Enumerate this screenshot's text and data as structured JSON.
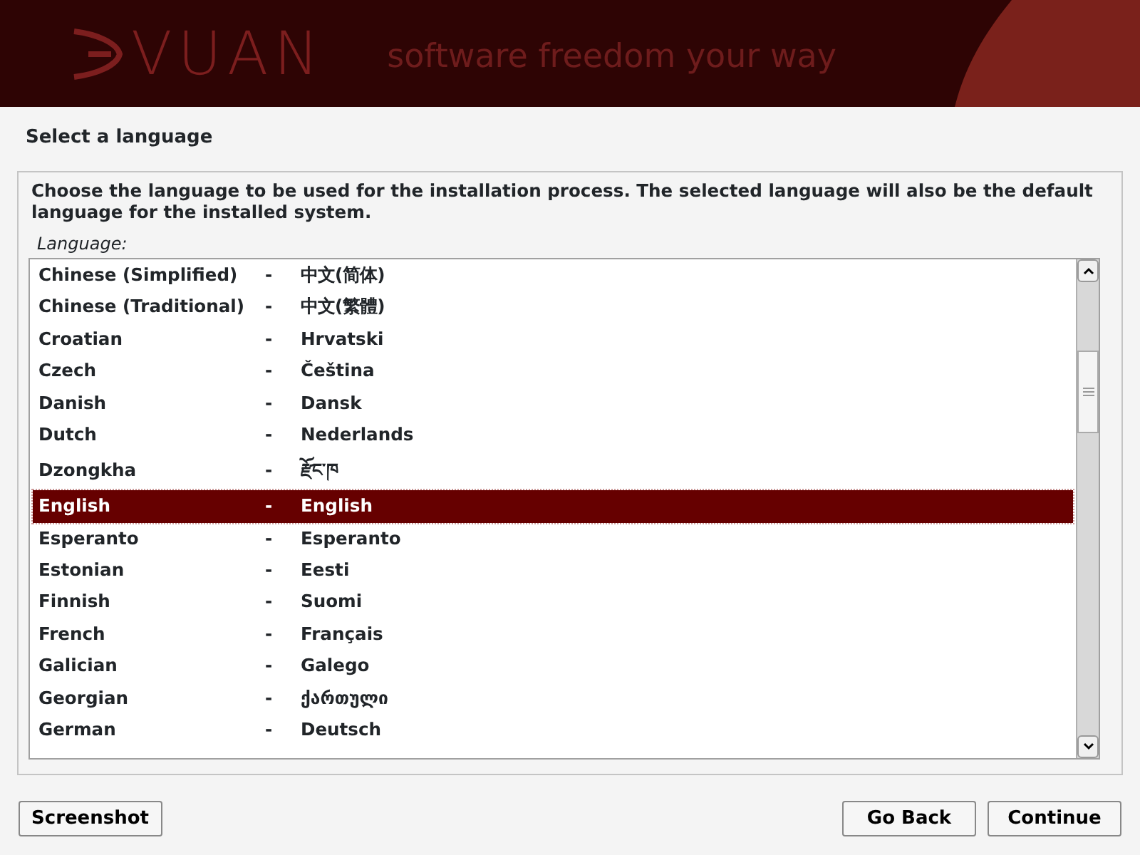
{
  "header": {
    "brand": "VUAN",
    "tagline": "software freedom your way"
  },
  "title": "Select a language",
  "description": "Choose the language to be used for the installation process. The selected language will also be the default language for the installed system.",
  "list_label": "Language:",
  "languages": [
    {
      "name": "Chinese (Simplified)",
      "separator": "-",
      "native": "中文(简体)",
      "selected": false
    },
    {
      "name": "Chinese (Traditional)",
      "separator": "-",
      "native": "中文(繁體)",
      "selected": false
    },
    {
      "name": "Croatian",
      "separator": "-",
      "native": "Hrvatski",
      "selected": false
    },
    {
      "name": "Czech",
      "separator": "-",
      "native": "Čeština",
      "selected": false
    },
    {
      "name": "Danish",
      "separator": "-",
      "native": "Dansk",
      "selected": false
    },
    {
      "name": "Dutch",
      "separator": "-",
      "native": "Nederlands",
      "selected": false
    },
    {
      "name": "Dzongkha",
      "separator": "-",
      "native": "རྫོང་ཁ",
      "selected": false
    },
    {
      "name": "English",
      "separator": "-",
      "native": "English",
      "selected": true
    },
    {
      "name": "Esperanto",
      "separator": "-",
      "native": "Esperanto",
      "selected": false
    },
    {
      "name": "Estonian",
      "separator": "-",
      "native": "Eesti",
      "selected": false
    },
    {
      "name": "Finnish",
      "separator": "-",
      "native": "Suomi",
      "selected": false
    },
    {
      "name": "French",
      "separator": "-",
      "native": "Français",
      "selected": false
    },
    {
      "name": "Galician",
      "separator": "-",
      "native": "Galego",
      "selected": false
    },
    {
      "name": "Georgian",
      "separator": "-",
      "native": "ქართული",
      "selected": false
    },
    {
      "name": "German",
      "separator": "-",
      "native": "Deutsch",
      "selected": false
    }
  ],
  "buttons": [
    {
      "label": "Screenshot",
      "kind": "left"
    },
    {
      "label": "Go Back",
      "kind": "right"
    },
    {
      "label": "Continue",
      "kind": "right"
    }
  ]
}
